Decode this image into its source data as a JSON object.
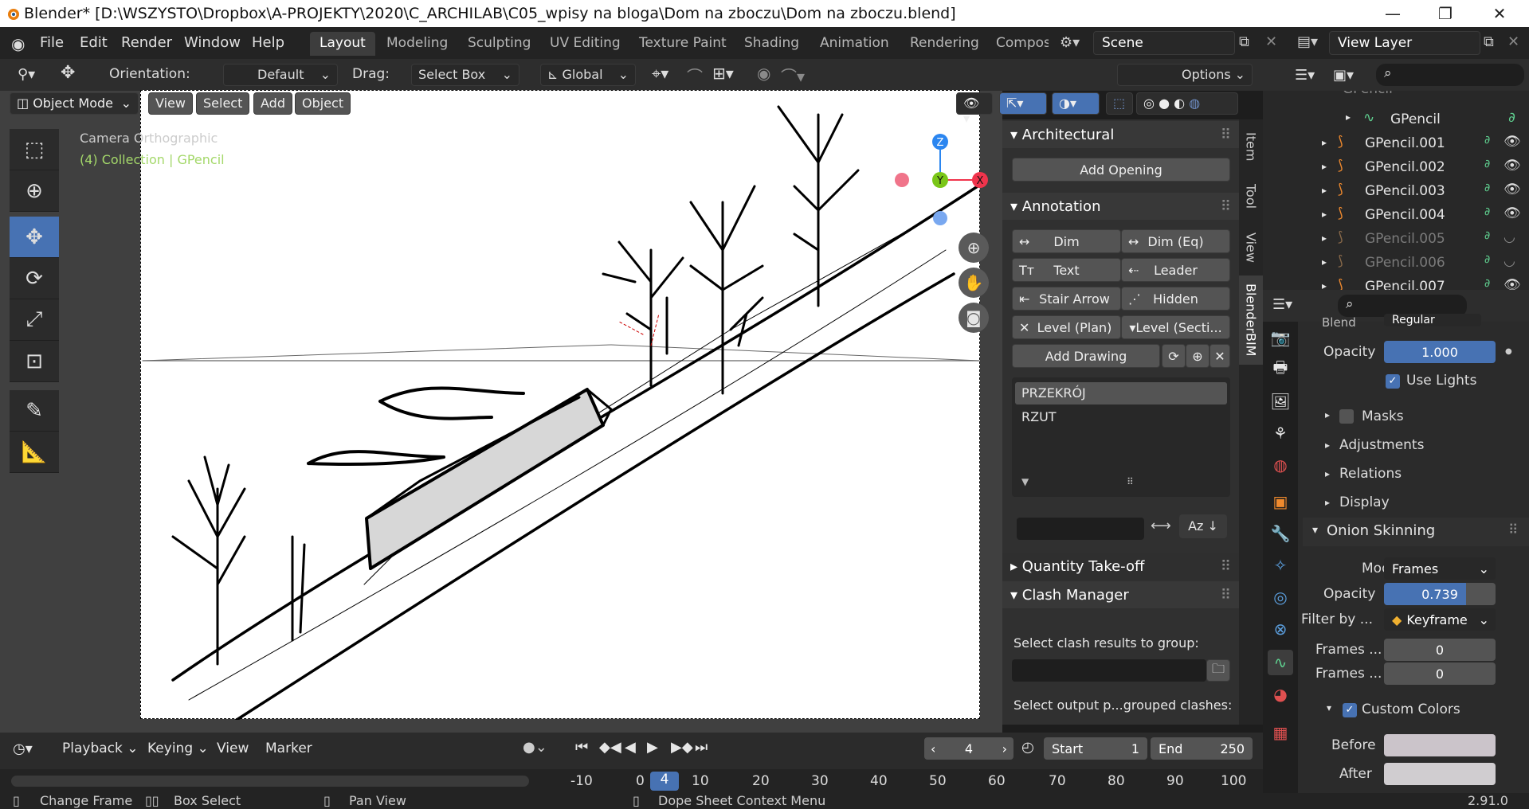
{
  "window": {
    "title": "Blender* [D:\\WSZYSTO\\Dropbox\\A-PROJEKTY\\2020\\C_ARCHILAB\\C05_wpisy na bloga\\Dom na zboczu\\Dom na zboczu.blend]"
  },
  "menu": [
    "File",
    "Edit",
    "Render",
    "Window",
    "Help"
  ],
  "workspaces": [
    "Layout",
    "Modeling",
    "Sculpting",
    "UV Editing",
    "Texture Paint",
    "Shading",
    "Animation",
    "Rendering",
    "Compos"
  ],
  "scene": "Scene",
  "view_layer": "View Layer",
  "tool_header": {
    "orientation_label": "Orientation:",
    "orientation_value": "Default",
    "drag_label": "Drag:",
    "drag_value": "Select Box",
    "transform_value": "Global",
    "options": "Options"
  },
  "viewport_header": {
    "mode": "Object Mode",
    "buttons": [
      "View",
      "Select",
      "Add",
      "Object"
    ]
  },
  "overlay_text": {
    "line1": "Camera Orthographic",
    "line2": "(4) Collection | GPencil"
  },
  "gizmo": {
    "z": "Z",
    "y": "Y",
    "x": "X"
  },
  "npanel": {
    "tabs": [
      "Item",
      "Tool",
      "View",
      "BlenderBIM"
    ],
    "architectural": {
      "title": "Architectural",
      "add_opening": "Add Opening"
    },
    "annotation": {
      "title": "Annotation",
      "rows": [
        [
          "Dim",
          "Dim (Eq)"
        ],
        [
          "Text",
          "Leader"
        ],
        [
          "Stair Arrow",
          "Hidden"
        ],
        [
          "Level (Plan)",
          "Level (Secti..."
        ]
      ],
      "add_drawing": "Add Drawing",
      "drawings": [
        "PRZEKRÓJ",
        "RZUT"
      ]
    },
    "quantity": "Quantity Take-off",
    "clash": {
      "title": "Clash Manager",
      "label1": "Select clash results to group:",
      "label2": "Select output p...grouped clashes:"
    }
  },
  "outliner": {
    "items": [
      {
        "name": "GPencil",
        "dim": false
      },
      {
        "name": "GPencil.001",
        "dim": false
      },
      {
        "name": "GPencil.002",
        "dim": false
      },
      {
        "name": "GPencil.003",
        "dim": false
      },
      {
        "name": "GPencil.004",
        "dim": false
      },
      {
        "name": "GPencil.005",
        "dim": true
      },
      {
        "name": "GPencil.006",
        "dim": true
      },
      {
        "name": "GPencil.007",
        "dim": false
      }
    ]
  },
  "properties": {
    "blend_label": "Blend",
    "blend_value": "Regular",
    "opacity_label": "Opacity",
    "opacity_value": "1.000",
    "use_lights": "Use Lights",
    "sections": [
      "Masks",
      "Adjustments",
      "Relations",
      "Display"
    ],
    "onion": {
      "title": "Onion Skinning",
      "mode_label": "Mode",
      "mode_value": "Frames",
      "opacity_label": "Opacity",
      "opacity_value": "0.739",
      "opacity_fraction": 0.739,
      "filter_label": "Filter by ...",
      "filter_value": "Keyframe",
      "frames_before_label": "Frames ...",
      "frames_before": "0",
      "frames_after_label": "Frames ...",
      "frames_after": "0",
      "custom_colors": "Custom Colors",
      "before_label": "Before",
      "after_label": "After"
    }
  },
  "timeline": {
    "menus": [
      "Playback",
      "Keying",
      "View",
      "Marker"
    ],
    "current_frame": "4",
    "start_label": "Start",
    "start": "1",
    "end_label": "End",
    "end": "250",
    "ruler": [
      "-10",
      "0",
      "4",
      "10",
      "20",
      "30",
      "40",
      "50",
      "60",
      "70",
      "80",
      "90",
      "100"
    ]
  },
  "status": {
    "items": [
      "Change Frame",
      "Box Select",
      "Pan View",
      "Dope Sheet Context Menu"
    ],
    "version": "2.91.0"
  },
  "colors": {
    "accent": "#4772b3",
    "header": "#2d2d2d",
    "panel": "#303030"
  }
}
